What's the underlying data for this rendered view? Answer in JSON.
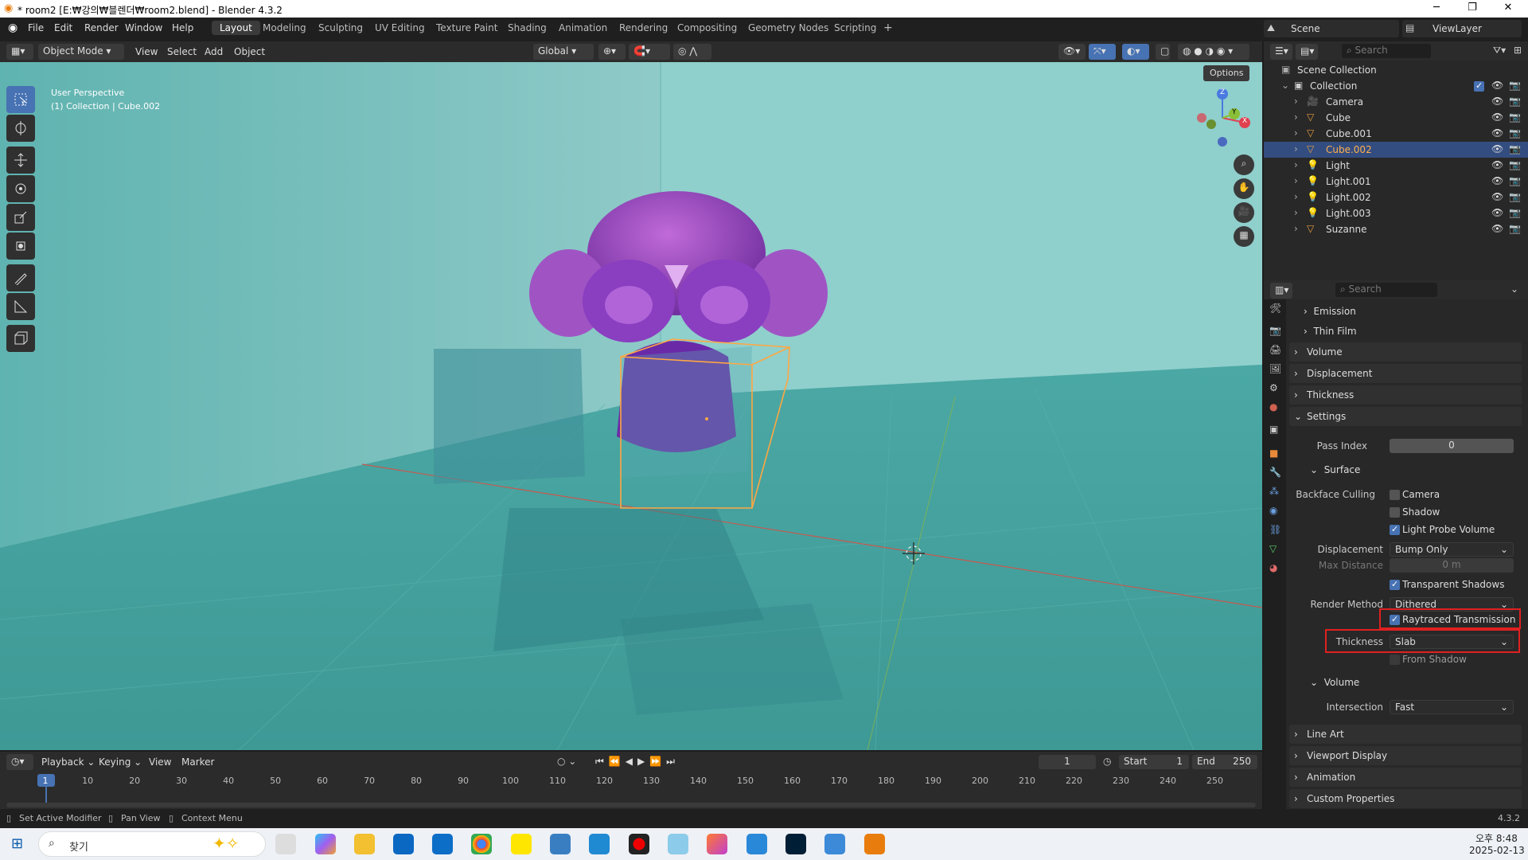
{
  "titlebar": {
    "title": "* room2 [E:₩강의₩블렌더₩room2.blend] - Blender 4.3.2"
  },
  "menu": [
    "File",
    "Edit",
    "Render",
    "Window",
    "Help"
  ],
  "workspaces": [
    "Layout",
    "Modeling",
    "Sculpting",
    "UV Editing",
    "Texture Paint",
    "Shading",
    "Animation",
    "Rendering",
    "Compositing",
    "Geometry Nodes",
    "Scripting"
  ],
  "scene": {
    "scene_name": "Scene",
    "view_layer": "ViewLayer"
  },
  "viewport_header": {
    "mode": "Object Mode",
    "menus": [
      "View",
      "Select",
      "Add",
      "Object"
    ],
    "orientation": "Global",
    "options": "Options"
  },
  "viewport": {
    "perspective": "User Perspective",
    "collection_info": "(1) Collection | Cube.002",
    "gizmo_axes": [
      "Z",
      "Y",
      "X"
    ]
  },
  "outliner": {
    "search_placeholder": "Search",
    "scene_collection": "Scene Collection",
    "collection": "Collection",
    "items": [
      "Camera",
      "Cube",
      "Cube.001",
      "Cube.002",
      "Light",
      "Light.001",
      "Light.002",
      "Light.003",
      "Suzanne"
    ]
  },
  "properties": {
    "search_placeholder": "Search",
    "emission": "Emission",
    "thin_film": "Thin Film",
    "volume": "Volume",
    "displacement": "Displacement",
    "thickness": "Thickness",
    "settings": "Settings",
    "pass_index_label": "Pass Index",
    "pass_index_value": "0",
    "surface": "Surface",
    "backface_culling_label": "Backface Culling",
    "camera": "Camera",
    "shadow": "Shadow",
    "light_probe_volume": "Light Probe Volume",
    "displacement_label": "Displacement",
    "displacement_value": "Bump Only",
    "max_distance_label": "Max Distance",
    "max_distance_value": "0 m",
    "transparent_shadows": "Transparent Shadows",
    "render_method_label": "Render Method",
    "render_method_value": "Dithered",
    "raytraced_transmission": "Raytraced Transmission",
    "thickness_label": "Thickness",
    "thickness_value": "Slab",
    "from_shadow": "From Shadow",
    "volume_sub": "Volume",
    "intersection_label": "Intersection",
    "intersection_value": "Fast",
    "line_art": "Line Art",
    "viewport_display": "Viewport Display",
    "animation": "Animation",
    "custom_properties": "Custom Properties"
  },
  "timeline": {
    "menus": [
      "Playback",
      "Keying",
      "View",
      "Marker"
    ],
    "current_frame": "1",
    "start_label": "Start",
    "start_value": "1",
    "end_label": "End",
    "end_value": "250",
    "frame_marks": [
      "1",
      "10",
      "20",
      "30",
      "40",
      "50",
      "60",
      "70",
      "80",
      "90",
      "100",
      "110",
      "120",
      "130",
      "140",
      "150",
      "160",
      "170",
      "180",
      "190",
      "200",
      "210",
      "220",
      "230",
      "240",
      "250"
    ]
  },
  "statusbar": {
    "hint1": "Set Active Modifier",
    "hint2": "Pan View",
    "hint3": "Context Menu",
    "version": "4.3.2"
  },
  "taskbar": {
    "search": "찾기",
    "time": "오후 8:48",
    "date": "2025-02-13"
  },
  "colors": {
    "accent": "#4772b3",
    "selection": "#ffa742",
    "highlight_box": "#e02020",
    "viewport": "#4aa6a2"
  }
}
